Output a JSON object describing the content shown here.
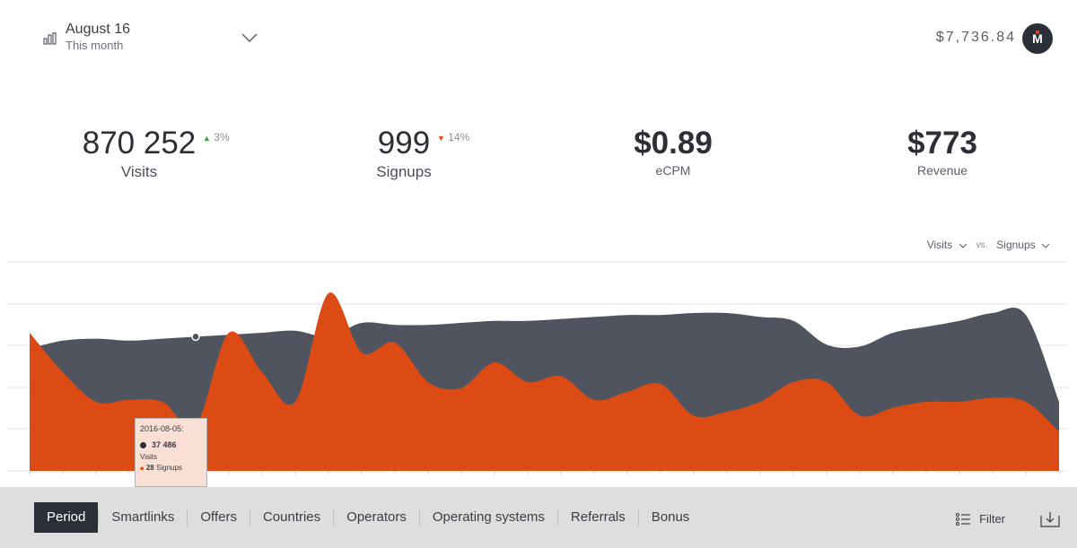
{
  "header": {
    "period_title": "August 16",
    "period_sub": "This month",
    "balance": "$7,736.84",
    "avatar_letter": "M"
  },
  "stats": [
    {
      "value": "870 252",
      "label": "Visits",
      "trend": "3%",
      "trend_dir": "up"
    },
    {
      "value": "999",
      "label": "Signups",
      "trend": "14%",
      "trend_dir": "down"
    },
    {
      "value": "$0.89",
      "label": "eCPM"
    },
    {
      "value": "$773",
      "label": "Revenue"
    }
  ],
  "compare": {
    "left": "Visits",
    "vs": "vs.",
    "right": "Signups"
  },
  "tooltip": {
    "date": "2016-08-05:",
    "visits_value": "37 486",
    "visits_label": "Visits",
    "signups_value": "28",
    "signups_label": "Signups"
  },
  "chart_data": {
    "type": "area",
    "colors": {
      "visits": "#50545e",
      "signups": "#dd4b14"
    },
    "series": [
      {
        "name": "Visits",
        "values": [
          0.62,
          0.66,
          0.67,
          0.66,
          0.67,
          0.68,
          0.69,
          0.7,
          0.71,
          0.68,
          0.75,
          0.74,
          0.74,
          0.75,
          0.76,
          0.76,
          0.77,
          0.78,
          0.79,
          0.79,
          0.8,
          0.8,
          0.78,
          0.76,
          0.64,
          0.63,
          0.7,
          0.73,
          0.76,
          0.8,
          0.79,
          0.35
        ]
      },
      {
        "name": "Signups",
        "values": [
          0.7,
          0.5,
          0.35,
          0.36,
          0.35,
          0.23,
          0.7,
          0.5,
          0.35,
          0.9,
          0.6,
          0.65,
          0.45,
          0.42,
          0.55,
          0.45,
          0.48,
          0.36,
          0.4,
          0.44,
          0.28,
          0.3,
          0.35,
          0.45,
          0.45,
          0.28,
          0.32,
          0.35,
          0.35,
          0.37,
          0.35,
          0.2
        ]
      }
    ]
  },
  "nav": {
    "tabs": [
      "Period",
      "Smartlinks",
      "Offers",
      "Countries",
      "Operators",
      "Operating systems",
      "Referrals",
      "Bonus"
    ],
    "active": 0,
    "filter_label": "Filter"
  }
}
